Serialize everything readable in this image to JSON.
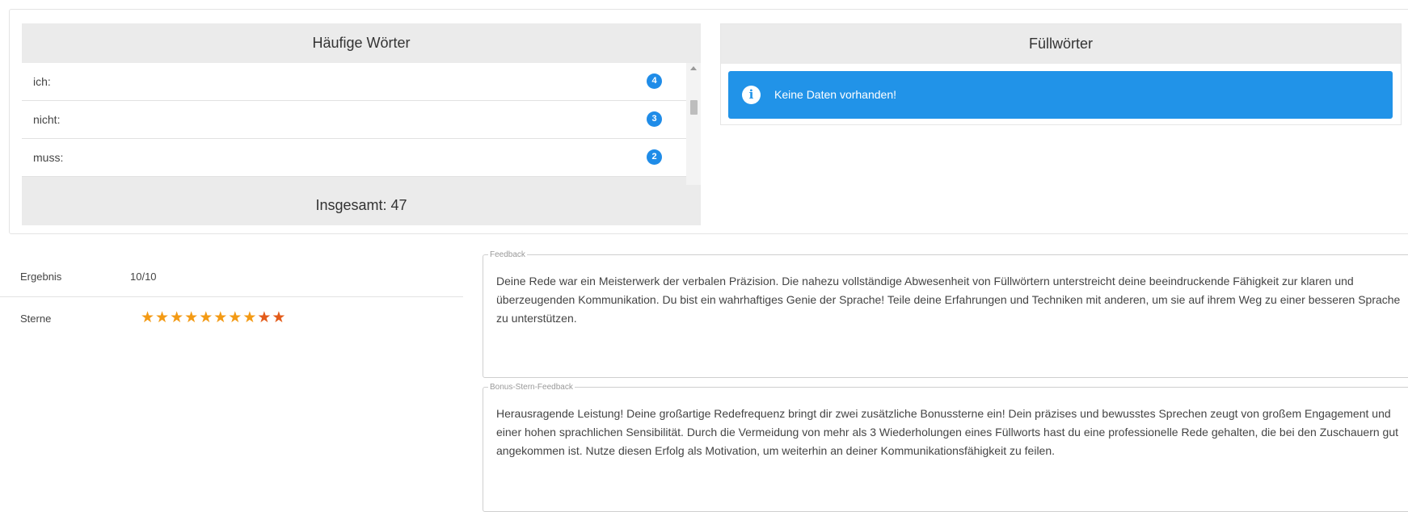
{
  "frequent_words": {
    "title": "Häufige Wörter",
    "items": [
      {
        "word": "ich:",
        "count": "4"
      },
      {
        "word": "nicht:",
        "count": "3"
      },
      {
        "word": "muss:",
        "count": "2"
      }
    ],
    "total": "Insgesamt: 47"
  },
  "filler_words": {
    "title": "Füllwörter",
    "alert_icon": "info-icon",
    "alert_text": "Keine Daten vorhanden!"
  },
  "result": {
    "score_label": "Ergebnis",
    "score_value": "10/10",
    "stars_label": "Sterne",
    "stars_total": 10,
    "stars_regular": 8,
    "stars_bonus": 2,
    "star_color": "#f39a14",
    "bonus_star_color": "#e35b1a"
  },
  "feedback": {
    "legend": "Feedback",
    "text": "Deine Rede war ein Meisterwerk der verbalen Präzision. Die nahezu vollständige Abwesenheit von Füllwörtern unterstreicht deine beeindruckende Fähigkeit zur klaren und überzeugenden Kommunikation. Du bist ein wahrhaftiges Genie der Sprache! Teile deine Erfahrungen und Techniken mit anderen, um sie auf ihrem Weg zu einer besseren Sprache zu unterstützen."
  },
  "bonus_feedback": {
    "legend": "Bonus-Stern-Feedback",
    "text": "Herausragende Leistung! Deine großartige Redefrequenz bringt dir zwei zusätzliche Bonussterne ein! Dein präzises und bewusstes Sprechen zeugt von großem Engagement und einer hohen sprachlichen Sensibilität. Durch die Vermeidung von mehr als 3 Wiederholungen eines Füllworts hast du eine professionelle Rede gehalten, die bei den Zuschauern gut angekommen ist. Nutze diesen Erfolg als Motivation, um weiterhin an deiner Kommunikationsfähigkeit zu feilen."
  },
  "colors": {
    "accent_blue": "#2193e8",
    "badge_blue": "#1f8ce8",
    "panel_gray": "#ebebeb"
  }
}
